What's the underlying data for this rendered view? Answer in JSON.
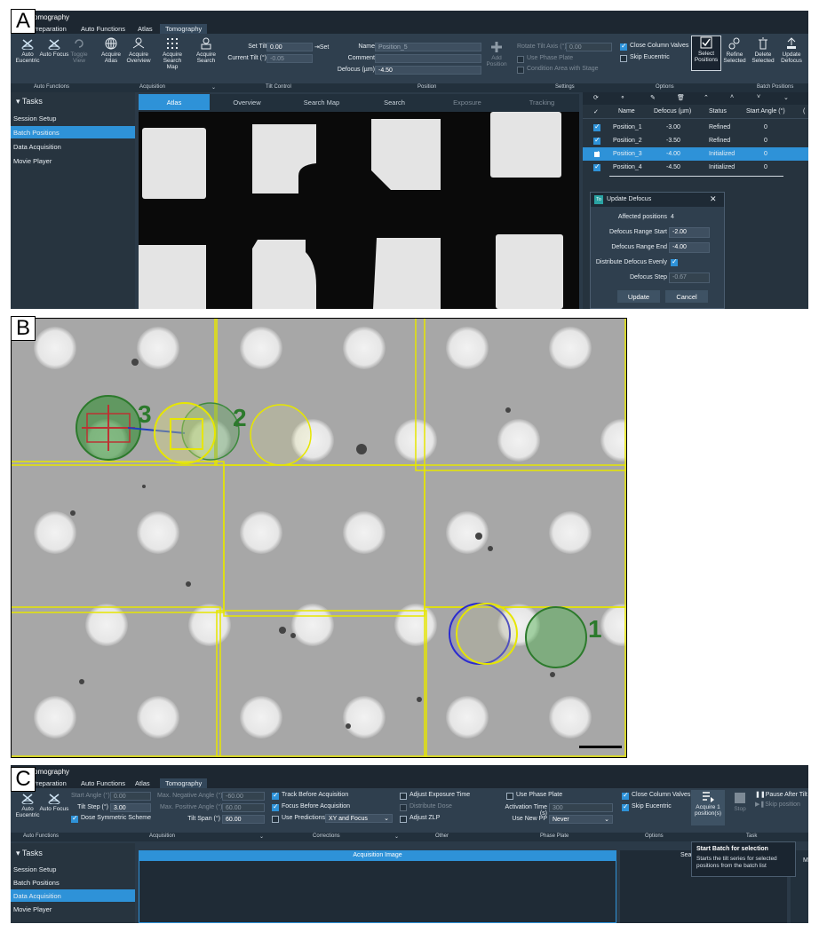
{
  "panel_labels": {
    "a": "A",
    "b": "B",
    "c": "C"
  },
  "app": {
    "title": "Tomography"
  },
  "tabs": [
    "Preparation",
    "Auto Functions",
    "Atlas",
    "Tomography"
  ],
  "a": {
    "ribbon": {
      "btn_auto_eucentric": "Auto Eucentric",
      "btn_auto_focus": "Auto Focus",
      "btn_toggle_view": "Toggle View",
      "btn_acquire_atlas": "Acquire Atlas",
      "btn_acquire_overview": "Acquire Overview",
      "btn_acquire_search_map": "Acquire Search Map",
      "btn_acquire_search": "Acquire Search",
      "set_tilt_label": "Set Tilt (°)",
      "set_tilt_value": "0.00",
      "set_button": "Set",
      "current_tilt_label": "Current Tilt (°)",
      "current_tilt_value": "-0.05",
      "name_label": "Name",
      "name_value": "Position_5",
      "comment_label": "Comment",
      "comment_value": "",
      "defocus_label": "Defocus (µm)",
      "defocus_value": "-4.50",
      "add_position": "Add Position",
      "rotate_tilt_label": "Rotate Tilt Axis (°)",
      "rotate_tilt_value": "0.00",
      "use_phase_plate": "Use Phase Plate",
      "condition_area": "Condition Area with Stage",
      "close_column_valves": "Close Column Valves",
      "skip_eucentric": "Skip Eucentric",
      "btn_select_positions": "Select Positions",
      "btn_refine_selected": "Refine Selected",
      "btn_delete_selected": "Delete Selected",
      "btn_update_defocus": "Update Defocus"
    },
    "groups": {
      "auto_functions": "Auto Functions",
      "acquisition": "Acquisition",
      "tilt_control": "Tilt Control",
      "position": "Position",
      "settings": "Settings",
      "options": "Options",
      "batch_positions": "Batch Positions"
    },
    "tasks_title": "Tasks",
    "tasks": [
      "Session Setup",
      "Batch Positions",
      "Data Acquisition",
      "Movie Player"
    ],
    "wizard": [
      "Atlas",
      "Overview",
      "Search Map",
      "Search",
      "Exposure",
      "Tracking"
    ],
    "table": {
      "headers": [
        "✓",
        "Name",
        "Defocus (µm)",
        "Status",
        "Start Angle (°)",
        "("
      ],
      "rows": [
        {
          "name": "Position_1",
          "defocus": "-3.00",
          "status": "Refined",
          "angle": "0"
        },
        {
          "name": "Position_2",
          "defocus": "-3.50",
          "status": "Refined",
          "angle": "0"
        },
        {
          "name": "Position_3",
          "defocus": "-4.00",
          "status": "Initialized",
          "angle": "0"
        },
        {
          "name": "Position_4",
          "defocus": "-4.50",
          "status": "Initialized",
          "angle": "0"
        }
      ]
    },
    "dialog": {
      "icon": "To",
      "title": "Update Defocus",
      "affected_label": "Affected positions",
      "affected_value": "4",
      "range_start_label": "Defocus Range Start",
      "range_start_value": "-2.00",
      "range_end_label": "Defocus Range End",
      "range_end_value": "-4.00",
      "distribute_label": "Distribute Defocus Evenly",
      "step_label": "Defocus Step",
      "step_value": "-0.67",
      "update_button": "Update",
      "cancel_button": "Cancel"
    }
  },
  "b": {
    "labels": [
      "3",
      "2",
      "1"
    ]
  },
  "c": {
    "ribbon": {
      "btn_auto_eucentric": "Auto Eucentric",
      "btn_auto_focus": "Auto Focus",
      "start_angle_label": "Start Angle (°)",
      "start_angle_value": "0.00",
      "tilt_step_label": "Tilt Step (°)",
      "tilt_step_value": "3.00",
      "dose_symmetric": "Dose Symmetric Scheme",
      "max_neg_label": "Max. Negative Angle (°)",
      "max_neg_value": "-60.00",
      "max_pos_label": "Max. Positive Angle (°)",
      "max_pos_value": "60.00",
      "tilt_span_label": "Tilt Span (°)",
      "tilt_span_value": "60.00",
      "track_before": "Track Before Acquisition",
      "focus_before": "Focus Before Acquisition",
      "use_predictions": "Use Predictions",
      "predictions_value": "XY and Focus",
      "adjust_exposure": "Adjust Exposure Time",
      "distribute_dose": "Distribute Dose",
      "adjust_zlp": "Adjust ZLP",
      "use_phase_plate": "Use Phase Plate",
      "activation_label": "Activation Time (s)",
      "activation_value": "300",
      "use_new_pp_label": "Use New PP",
      "use_new_pp_value": "Never",
      "close_column_valves": "Close Column Valves",
      "skip_eucentric": "Skip Eucentric",
      "btn_acquire": "Acquire 1 position(s)",
      "btn_stop": "Stop",
      "pause_after_tilt": "Pause After Tilt",
      "skip_position": "Skip position"
    },
    "groups": {
      "auto_functions": "Auto Functions",
      "acquisition": "Acquisition",
      "corrections": "Corrections",
      "other": "Other",
      "phase_plate": "Phase Plate",
      "options": "Options",
      "task": "Task"
    },
    "tasks_title": "Tasks",
    "tasks": [
      "Session Setup",
      "Batch Positions",
      "Data Acquisition",
      "Movie Player"
    ],
    "acq_image_title": "Acquisition Image",
    "sea_label": "Sea",
    "m_label": "M",
    "tooltip": {
      "title": "Start Batch for selection",
      "body": "Starts the tilt series for selected positions from the batch list"
    }
  }
}
